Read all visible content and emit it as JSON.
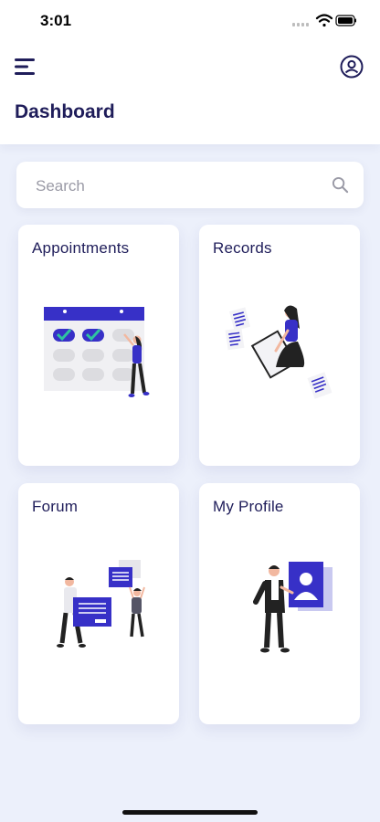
{
  "status_bar": {
    "time": "3:01"
  },
  "header": {
    "title": "Dashboard"
  },
  "search": {
    "placeholder": "Search",
    "value": ""
  },
  "cards": [
    {
      "title": "Appointments",
      "illustration": "calendar-illustration"
    },
    {
      "title": "Records",
      "illustration": "records-illustration"
    },
    {
      "title": "Forum",
      "illustration": "forum-illustration"
    },
    {
      "title": "My Profile",
      "illustration": "profile-illustration"
    }
  ],
  "colors": {
    "accent": "#3730c7",
    "title_text": "#1f1d5a",
    "background": "#ecf0fb",
    "check": "#2ec4a0"
  },
  "icons": [
    "menu-icon",
    "user-circle-icon",
    "search-icon",
    "signal-icon",
    "wifi-icon",
    "battery-icon"
  ]
}
